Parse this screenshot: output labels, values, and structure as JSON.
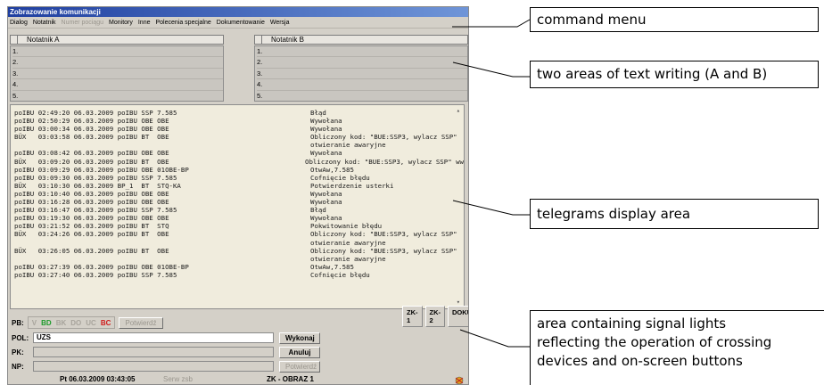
{
  "window": {
    "title": "Zobrazowanie komunikacji"
  },
  "menu": [
    {
      "label": "Dialog",
      "enabled": true
    },
    {
      "label": "Notatnik",
      "enabled": true
    },
    {
      "label": "Numer pociągu",
      "enabled": false
    },
    {
      "label": "Monitory",
      "enabled": true
    },
    {
      "label": "Inne",
      "enabled": true
    },
    {
      "label": "Polecenia specjalne",
      "enabled": true
    },
    {
      "label": "Dokumentowanie",
      "enabled": true
    },
    {
      "label": "Wersja",
      "enabled": true
    }
  ],
  "notepad_a": {
    "title": "Notatnik A",
    "lines": [
      "1.",
      "2.",
      "3.",
      "4.",
      "5."
    ]
  },
  "notepad_b": {
    "title": "Notatnik B",
    "lines": [
      "1.",
      "2.",
      "3.",
      "4.",
      "5."
    ]
  },
  "telegrams": [
    {
      "left": "poIBU 02:49:20 06.03.2009 poIBU SSP 7.585",
      "right": "Błąd"
    },
    {
      "left": "poIBU 02:50:29 06.03.2009 poIBU OBE OBE",
      "right": "Wywołana"
    },
    {
      "left": "poIBU 03:00:34 06.03.2009 poIBU OBE OBE",
      "right": "Wywołana"
    },
    {
      "left": "BÜX   03:03:58 06.03.2009 poIBU BT  OBE",
      "right": "Obliczony kod: \"BUE:SSP3, wylacz SSP\""
    },
    {
      "left": "",
      "right": "otwieranie awaryjne"
    },
    {
      "left": "poIBU 03:08:42 06.03.2009 poIBU OBE OBE",
      "right": "Wywołana"
    },
    {
      "left": "BÜX   03:09:20 06.03.2009 poIBU BT  OBE",
      "right": "Obliczony kod: \"BUE:SSP3, wylacz SSP\" ww"
    },
    {
      "left": "poIBU 03:09:29 06.03.2009 poIBU OBE 01OBE-BP",
      "right": "OtwAw,7.585"
    },
    {
      "left": "poIBU 03:09:30 06.03.2009 poIBU SSP 7.585",
      "right": "Cofnięcie błędu"
    },
    {
      "left": "BÜX   03:10:30 06.03.2009 BP_1  BT  STQ-KA",
      "right": "Potwierdzenie usterki"
    },
    {
      "left": "poIBU 03:10:40 06.03.2009 poIBU OBE OBE",
      "right": "Wywołana"
    },
    {
      "left": "poIBU 03:16:28 06.03.2009 poIBU OBE OBE",
      "right": "Wywołana"
    },
    {
      "left": "poIBU 03:16:47 06.03.2009 poIBU SSP 7.585",
      "right": "Błąd"
    },
    {
      "left": "poIBU 03:19:30 06.03.2009 poIBU OBE OBE",
      "right": "Wywołana"
    },
    {
      "left": "poIBU 03:21:52 06.03.2009 poIBU BT  STQ",
      "right": "Pokwitowanie błędu"
    },
    {
      "left": "BÜX   03:24:26 06.03.2009 poIBU BT  OBE",
      "right": "Obliczony kod: \"BUE:SSP3, wylacz SSP\""
    },
    {
      "left": "",
      "right": "otwieranie awaryjne"
    },
    {
      "left": "BÜX   03:26:05 06.03.2009 poIBU BT  OBE",
      "right": "Obliczony kod: \"BUE:SSP3, wylacz SSP\""
    },
    {
      "left": "",
      "right": "otwieranie awaryjne"
    },
    {
      "left": "poIBU 03:27:39 06.03.2009 poIBU OBE 01OBE-BP",
      "right": "OtwAw,7.585"
    },
    {
      "left": "poIBU 03:27:40 06.03.2009 poIBU SSP 7.585",
      "right": "Cofnięcie błędu"
    }
  ],
  "tabs": [
    "ZK-1",
    "ZK-2",
    "DOKU"
  ],
  "signals": {
    "label": "PB:",
    "lights": [
      {
        "text": "V",
        "color": "#a8a49c"
      },
      {
        "text": "BD",
        "color": "#1c9a2a"
      },
      {
        "text": "BK",
        "color": "#a8a49c"
      },
      {
        "text": "DO",
        "color": "#a8a49c"
      },
      {
        "text": "UC",
        "color": "#a8a49c"
      },
      {
        "text": "BC",
        "color": "#d01a1a"
      }
    ],
    "confirm_label": "Potwierdź"
  },
  "fields": {
    "pol": {
      "label": "POL:",
      "value": "UZS",
      "button": "Wykonaj"
    },
    "pk": {
      "label": "PK:",
      "value": "",
      "button": "Anuluj"
    },
    "np": {
      "label": "NP:",
      "value": "",
      "button": "Potwierdź"
    }
  },
  "status": {
    "datetime": "Pt 06.03.2009 03:43:05",
    "server": "Serw zsb",
    "screen": "ZK - OBRAZ 1"
  },
  "annotations": {
    "command_menu": "command menu",
    "notepads": "two areas of text writing (A and B)",
    "telegrams": "telegrams display area",
    "signals": [
      "area containing signal lights",
      "reflecting the operation of crossing",
      "devices and on-screen buttons"
    ]
  }
}
